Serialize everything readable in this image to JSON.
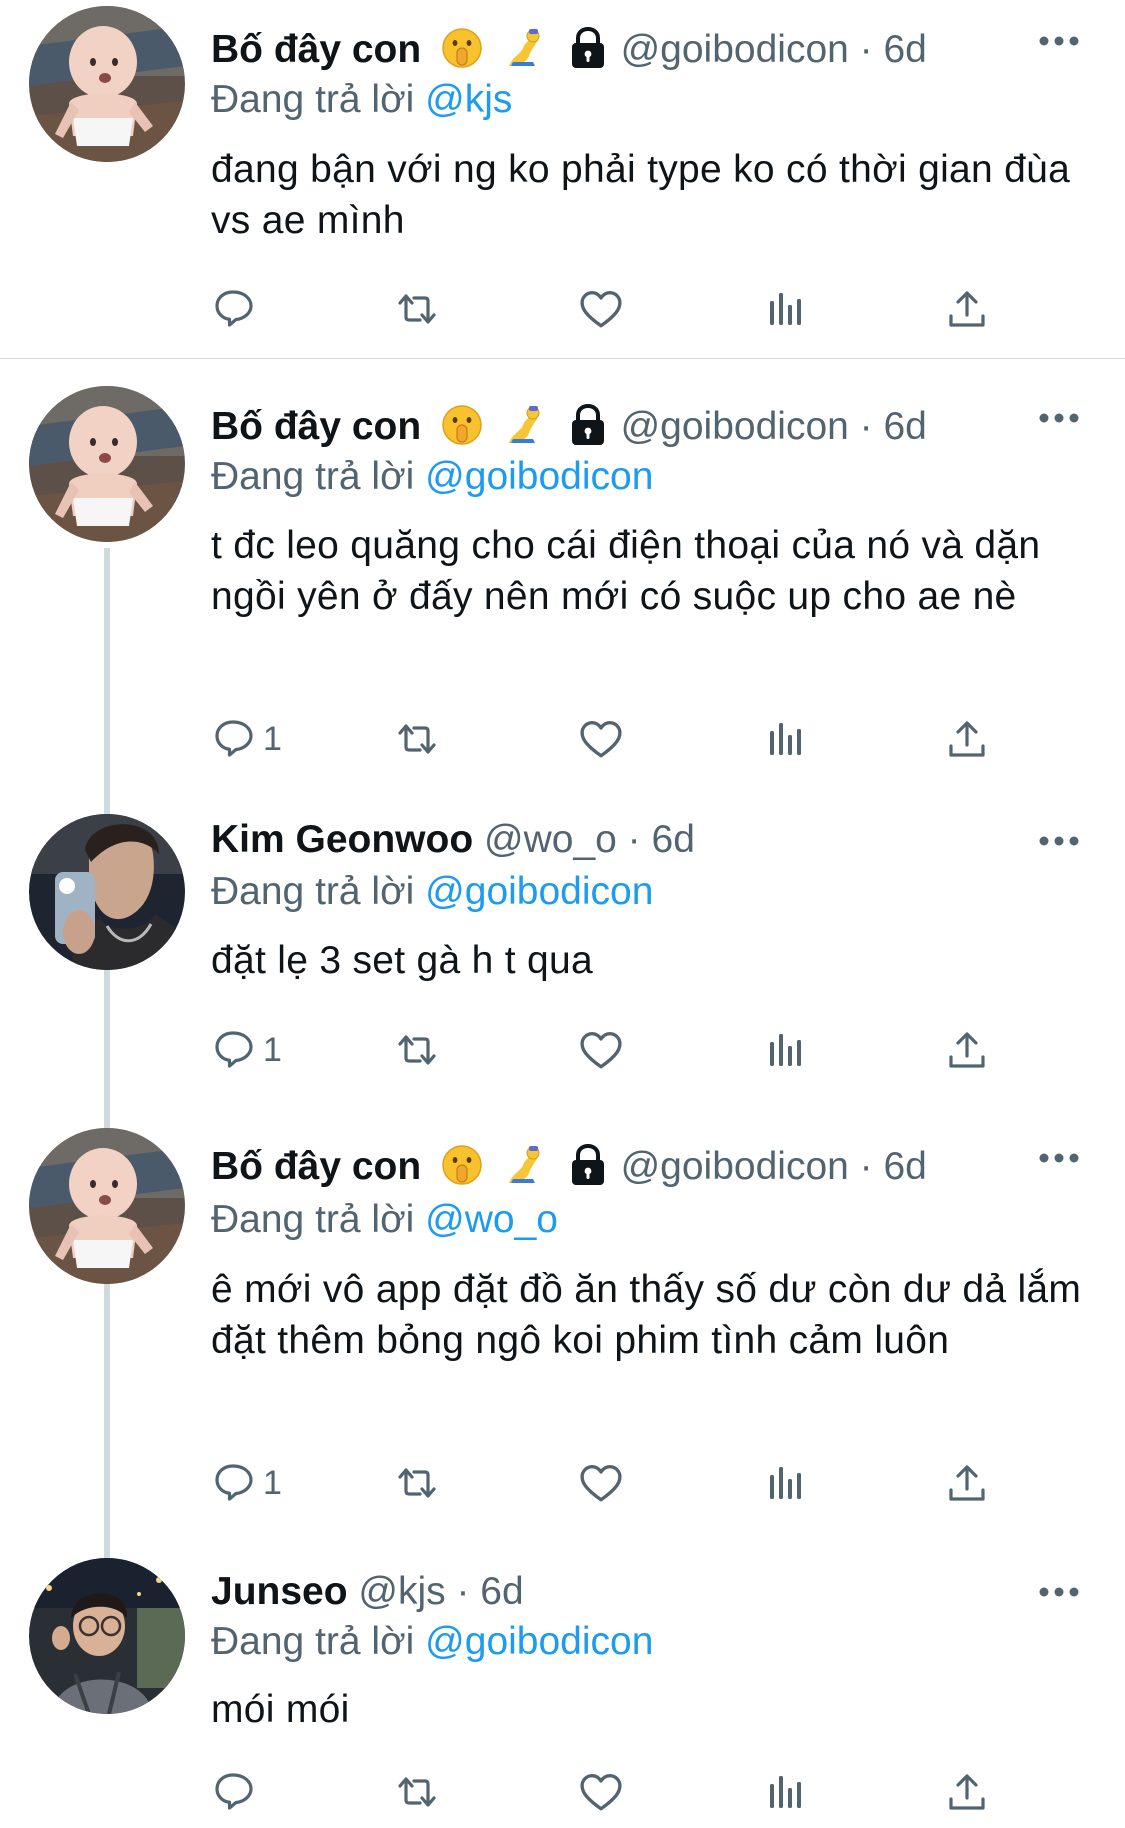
{
  "tweets": [
    {
      "name": "Bố đây con",
      "badges": [
        "shushing-face",
        "genie-emoji",
        "lock-icon"
      ],
      "handle": "@goibodicon · 6d",
      "replying_prefix": "Đang trả lời",
      "replying_to": "@kjs",
      "text": "đang bận với ng ko phải type ko có thời gian đùa vs ae mình",
      "reply_count": ""
    },
    {
      "name": "Bố đây con",
      "badges": [
        "shushing-face",
        "genie-emoji",
        "lock-icon"
      ],
      "handle": "@goibodicon · 6d",
      "replying_prefix": "Đang trả lời",
      "replying_to": "@goibodicon",
      "text": "t đc leo quăng cho cái điện thoại của nó và dặn ngồi yên ở đấy nên mới có suộc up cho ae nè",
      "reply_count": "1"
    },
    {
      "name": "Kim Geonwoo",
      "badges": [],
      "handle": "@wo_o · 6d",
      "replying_prefix": "Đang trả lời",
      "replying_to": "@goibodicon",
      "text": "đặt lẹ 3 set gà h t qua",
      "reply_count": "1"
    },
    {
      "name": "Bố đây con",
      "badges": [
        "shushing-face",
        "genie-emoji",
        "lock-icon"
      ],
      "handle": "@goibodicon · 6d",
      "replying_prefix": "Đang trả lời",
      "replying_to": "@wo_o",
      "text": "ê mới vô app đặt đồ ăn thấy số dư còn dư dả lắm đặt thêm bỏng ngô koi phim tình cảm luôn",
      "reply_count": "1"
    },
    {
      "name": "Junseo",
      "badges": [],
      "handle": "@kjs · 6d",
      "replying_prefix": "Đang trả lời",
      "replying_to": "@goibodicon",
      "text": "mói mói",
      "reply_count": ""
    }
  ],
  "colors": {
    "accent": "#1d9bf0",
    "secondary_text": "#536471",
    "primary_text": "#0f1419"
  },
  "action_icons": [
    "reply-icon",
    "retweet-icon",
    "like-icon",
    "views-icon",
    "share-icon"
  ]
}
